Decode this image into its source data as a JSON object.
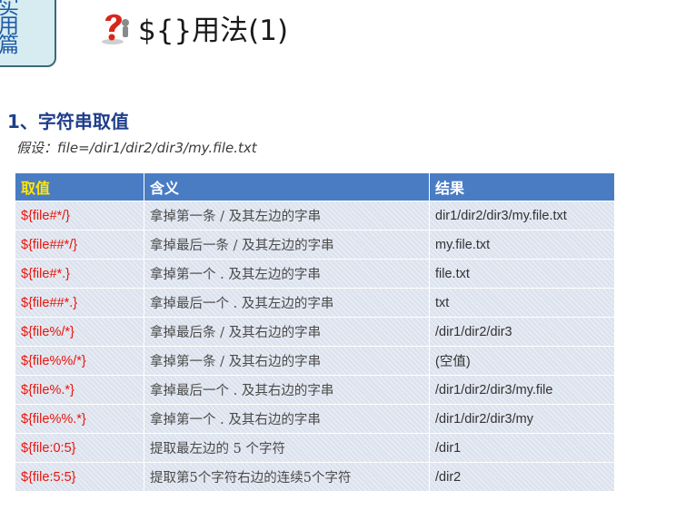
{
  "side_tab": {
    "text": "实用篇"
  },
  "title": {
    "text": "${}用法(1)"
  },
  "section": {
    "heading": "1、字符串取值"
  },
  "assumption": {
    "text": "假设：file=/dir1/dir2/dir3/my.file.txt"
  },
  "colors": {
    "header_bg": "#4a7cc4",
    "expr_red": "#e8140a",
    "first_header": "#ffe600",
    "row_bg": "#dde3ee"
  },
  "table": {
    "headers": [
      "取值",
      "含义",
      "结果"
    ],
    "rows": [
      {
        "expr": "${file#*/}",
        "meaning": "拿掉第一条 / 及其左边的字串",
        "result": "dir1/dir2/dir3/my.file.txt"
      },
      {
        "expr": "${file##*/}",
        "meaning": "拿掉最后一条 / 及其左边的字串",
        "result": "my.file.txt"
      },
      {
        "expr": "${file#*.}",
        "meaning": "拿掉第一个 . 及其左边的字串",
        "result": "file.txt"
      },
      {
        "expr": "${file##*.}",
        "meaning": "拿掉最后一个 . 及其左边的字串",
        "result": "txt"
      },
      {
        "expr": "${file%/*}",
        "meaning": "拿掉最后条 / 及其右边的字串",
        "result": "/dir1/dir2/dir3"
      },
      {
        "expr": "${file%%/*}",
        "meaning": "拿掉第一条 / 及其右边的字串",
        "result": "(空值)"
      },
      {
        "expr": "${file%.*}",
        "meaning": "拿掉最后一个 . 及其右边的字串",
        "result": "/dir1/dir2/dir3/my.file"
      },
      {
        "expr": "${file%%.*}",
        "meaning": "拿掉第一个 . 及其右边的字串",
        "result": "/dir1/dir2/dir3/my"
      },
      {
        "expr": "${file:0:5}",
        "meaning": "提取最左边的 5 个字符",
        "result": "/dir1"
      },
      {
        "expr": "${file:5:5}",
        "meaning": "提取第5个字符右边的连续5个字符",
        "result": "/dir2"
      }
    ]
  }
}
